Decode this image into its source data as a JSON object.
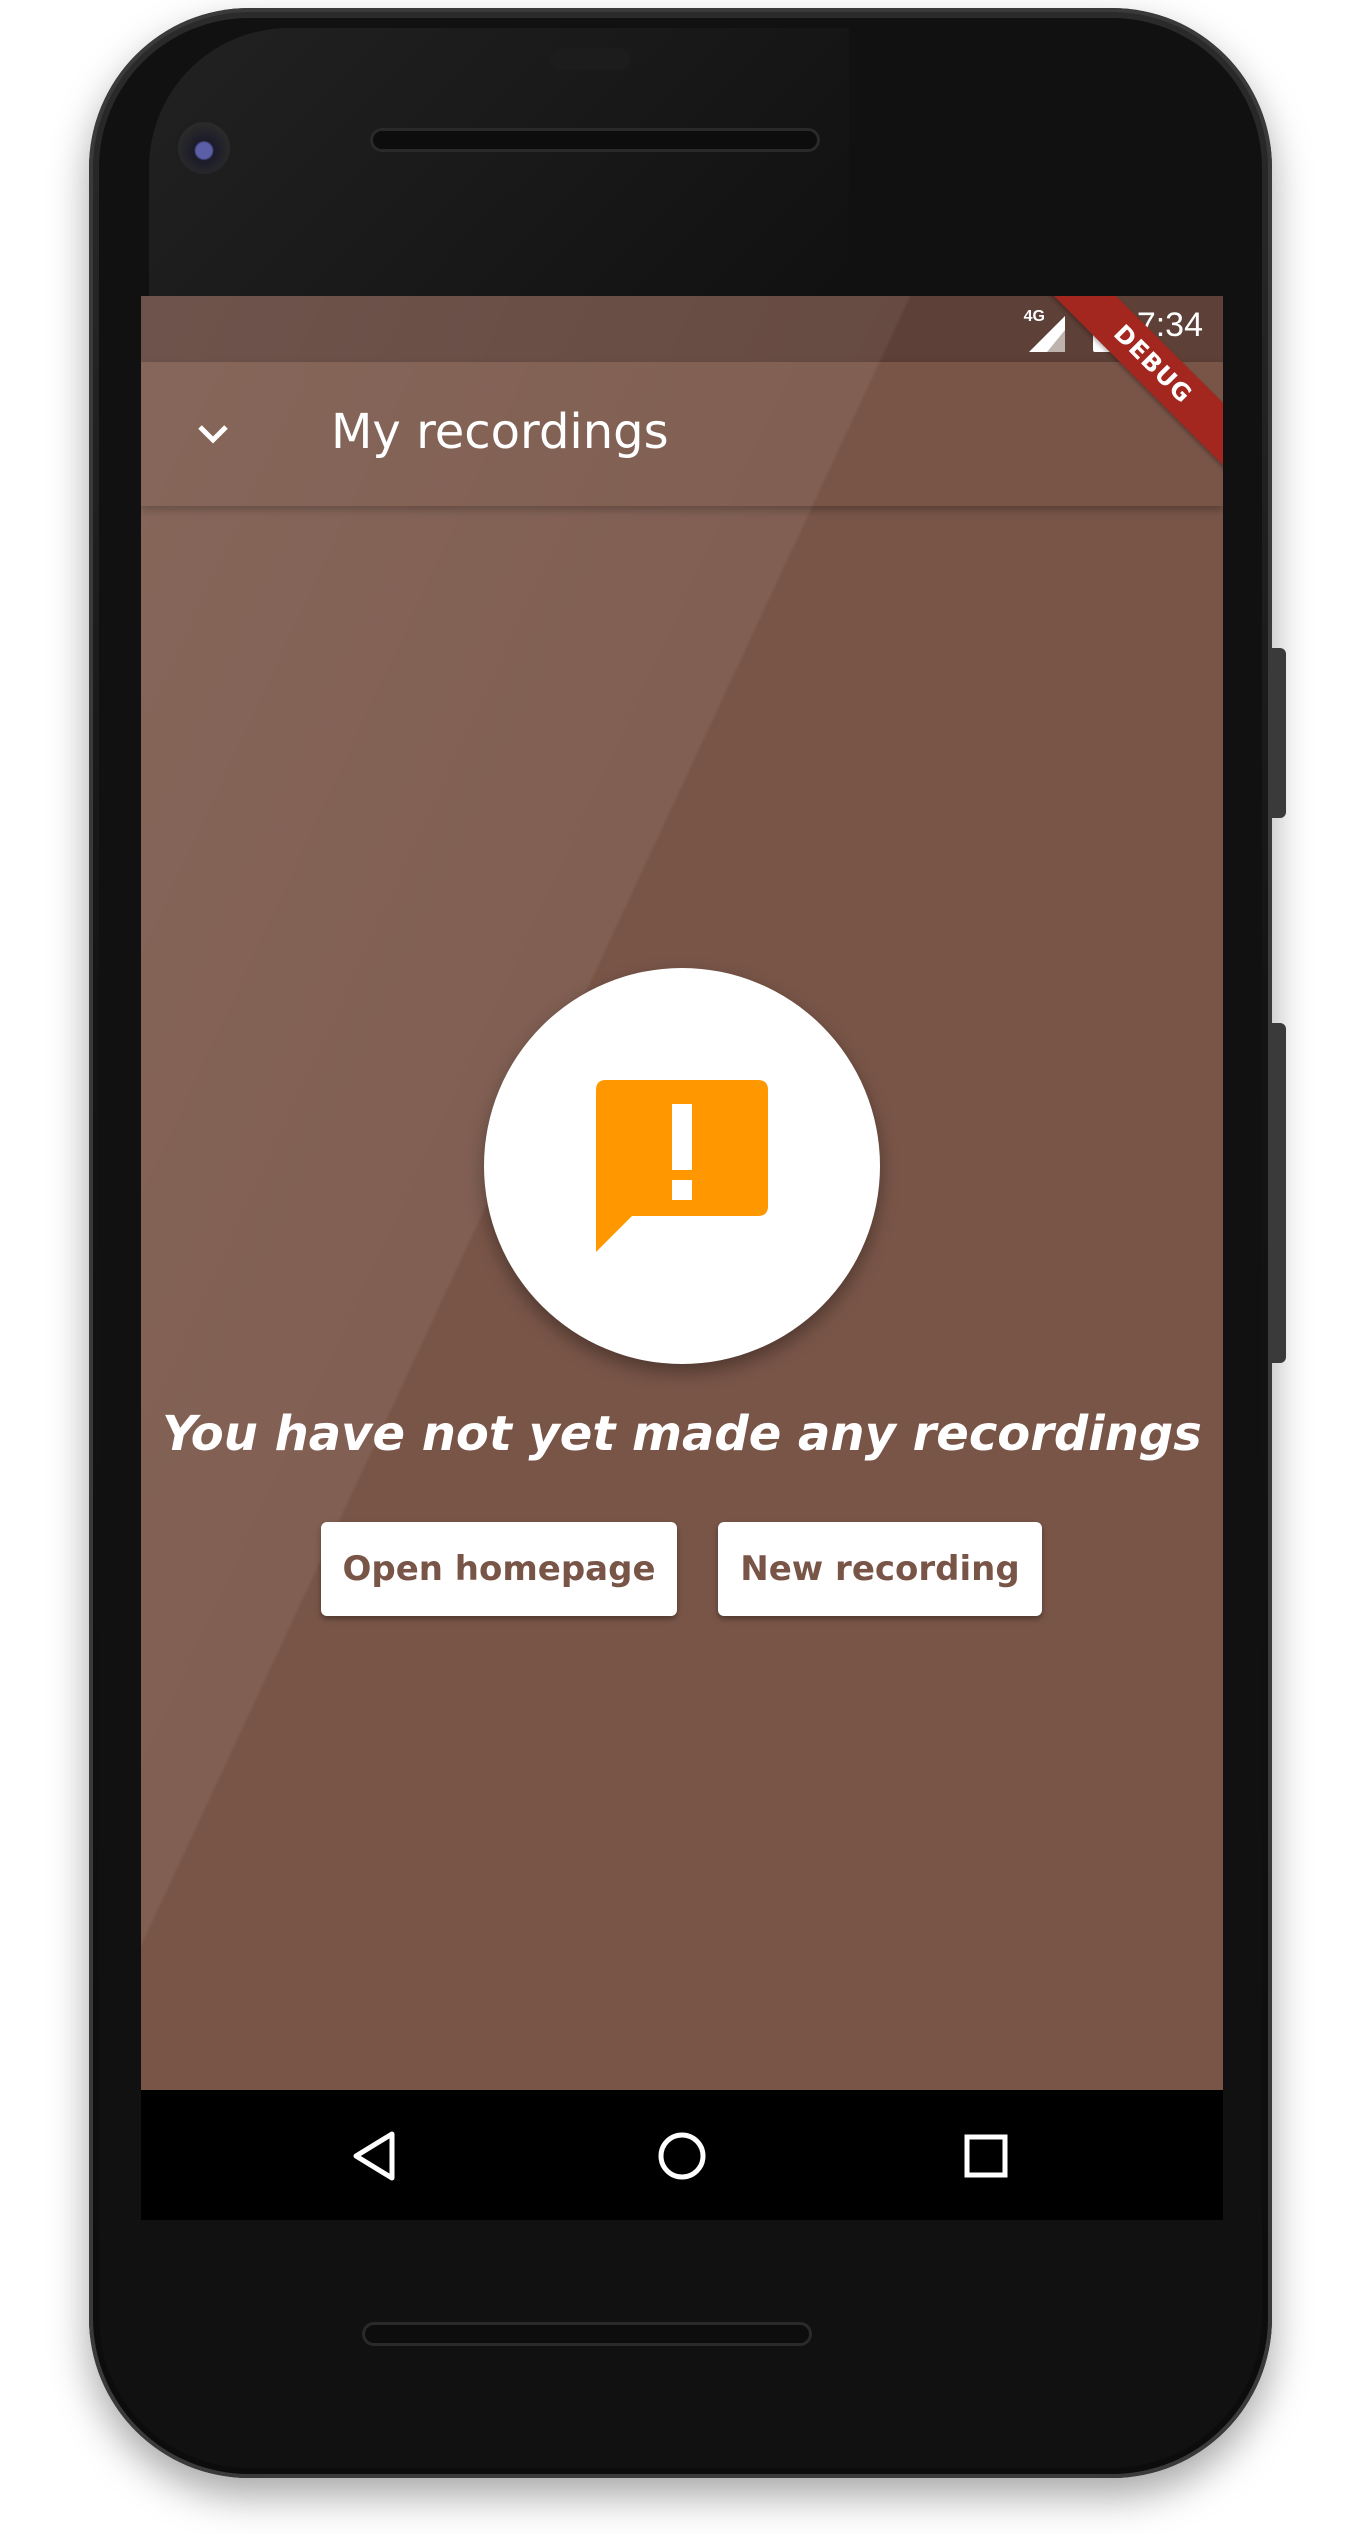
{
  "status_bar": {
    "network": "4G",
    "time": "7:34",
    "debug_banner": "DEBUG"
  },
  "app_bar": {
    "back_icon": "chevron-down-icon",
    "title": "My recordings"
  },
  "empty_state": {
    "icon": "feedback-alert-icon",
    "icon_color": "#FF9800",
    "message": "You have not yet made any recordings"
  },
  "actions": {
    "open_homepage": "Open homepage",
    "new_recording": "New recording"
  },
  "nav_bar": {
    "back_icon": "nav-back-icon",
    "home_icon": "nav-home-icon",
    "recents_icon": "nav-recents-icon"
  },
  "theme": {
    "primary": "#795548",
    "primary_dark": "#5D4037",
    "accent": "#FF9800"
  }
}
